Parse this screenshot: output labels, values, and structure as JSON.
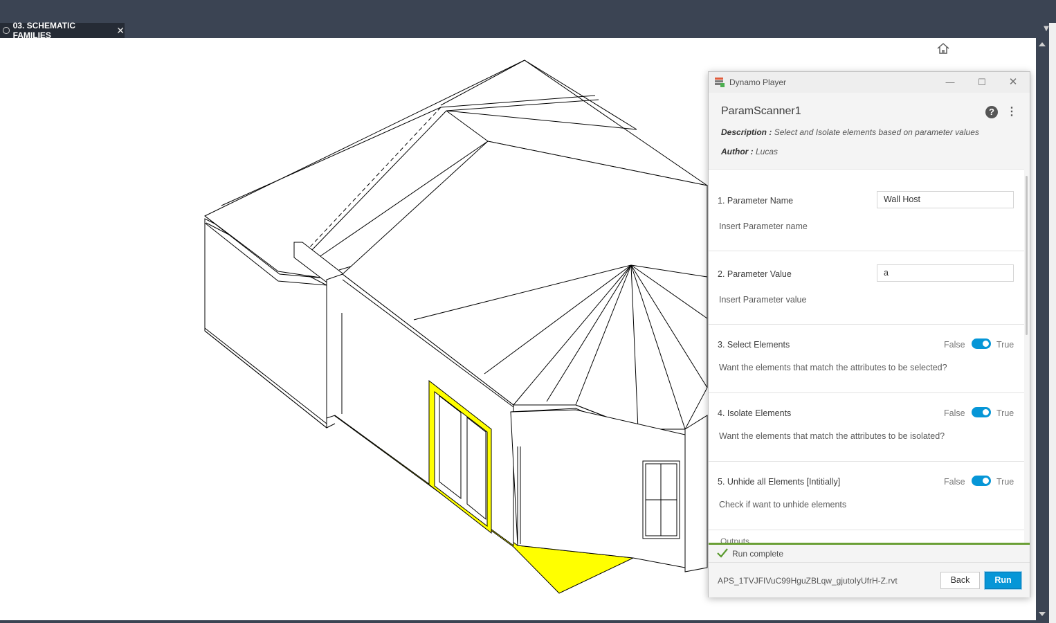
{
  "app": {
    "view_tab": "03. SCHEMATIC FAMILIES",
    "icons": {
      "tab": "view-3d-icon",
      "close": "close-icon",
      "home": "home-icon",
      "menu": "chevron-down-icon"
    }
  },
  "player": {
    "window_title": "Dynamo Player",
    "graph_name": "ParamScanner1",
    "description_label": "Description :",
    "description": "Select and Isolate elements based on parameter values",
    "author_label": "Author :",
    "author": "Lucas",
    "inputs": [
      {
        "label": "1. Parameter Name",
        "type": "text",
        "value": "Wall Host",
        "description": "Insert Parameter name"
      },
      {
        "label": "2. Parameter Value",
        "type": "text",
        "value": "a",
        "description": "Insert Parameter value"
      },
      {
        "label": "3. Select Elements",
        "type": "toggle",
        "value": true,
        "false_label": "False",
        "true_label": "True",
        "description": "Want the elements that match the attributes to be selected?"
      },
      {
        "label": "4. Isolate Elements",
        "type": "toggle",
        "value": true,
        "false_label": "False",
        "true_label": "True",
        "description": "Want the elements that match the attributes to be isolated?"
      },
      {
        "label": "5. Unhide all Elements [Intitially]",
        "type": "toggle",
        "value": true,
        "false_label": "False",
        "true_label": "True",
        "description": "Check if want to unhide elements"
      }
    ],
    "outputs_label": "Outputs",
    "status": "Run complete",
    "file_name": "APS_1TVJFIVuC99HguZBLqw_gjutoIyUfrH-Z.rvt",
    "back_label": "Back",
    "run_label": "Run",
    "colors": {
      "accent": "#0696d7",
      "status_bar": "#6a9f35",
      "highlight": "#ffff00"
    }
  }
}
